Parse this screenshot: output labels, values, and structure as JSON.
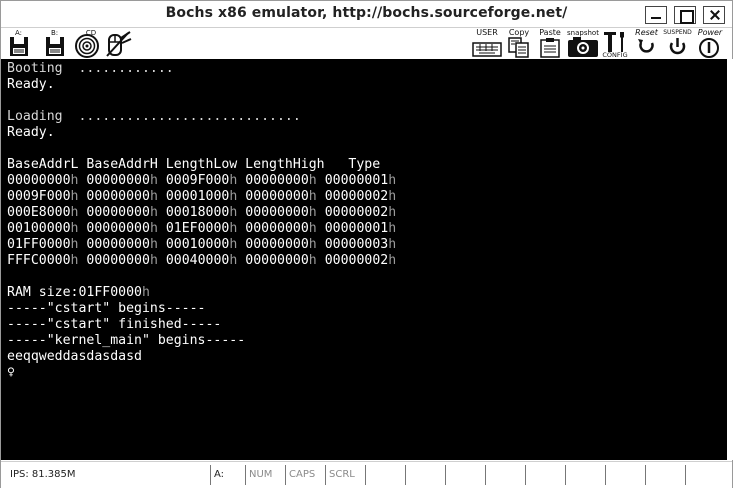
{
  "window": {
    "title": "Bochs x86 emulator, http://bochs.sourceforge.net/"
  },
  "toolbar": {
    "floppy_a_label": "A:",
    "floppy_b_label": "B:",
    "cdrom_label": "CD",
    "user_label": "USER",
    "copy_label": "Copy",
    "paste_label": "Paste",
    "snapshot_label": "snapshot",
    "config_label": "CONFIG",
    "reset_label": "Reset",
    "suspend_label": "SUSPEND",
    "power_label": "Power"
  },
  "console": {
    "lines": [
      "Booting  ............",
      "Ready.",
      "",
      "Loading  ............................",
      "Ready.",
      "",
      "BaseAddrL BaseAddrH LengthLow LengthHigh   Type",
      "00000000h 00000000h 0009F000h 00000000h 00000001h",
      "0009F000h 00000000h 00001000h 00000000h 00000002h",
      "000E8000h 00000000h 00018000h 00000000h 00000002h",
      "00100000h 00000000h 01EF0000h 00000000h 00000001h",
      "01FF0000h 00000000h 00010000h 00000000h 00000003h",
      "FFFC0000h 00000000h 00040000h 00000000h 00000002h",
      "",
      "RAM size:01FF0000h",
      "-----\"cstart\" begins-----",
      "-----\"cstart\" finished-----",
      "-----\"kernel_main\" begins-----",
      "eeqqweddasdasdasd",
      "♀"
    ]
  },
  "statusbar": {
    "ips": "IPS: 81.385M",
    "drive": "A:",
    "num": "NUM",
    "caps": "CAPS",
    "scrl": "SCRL"
  }
}
